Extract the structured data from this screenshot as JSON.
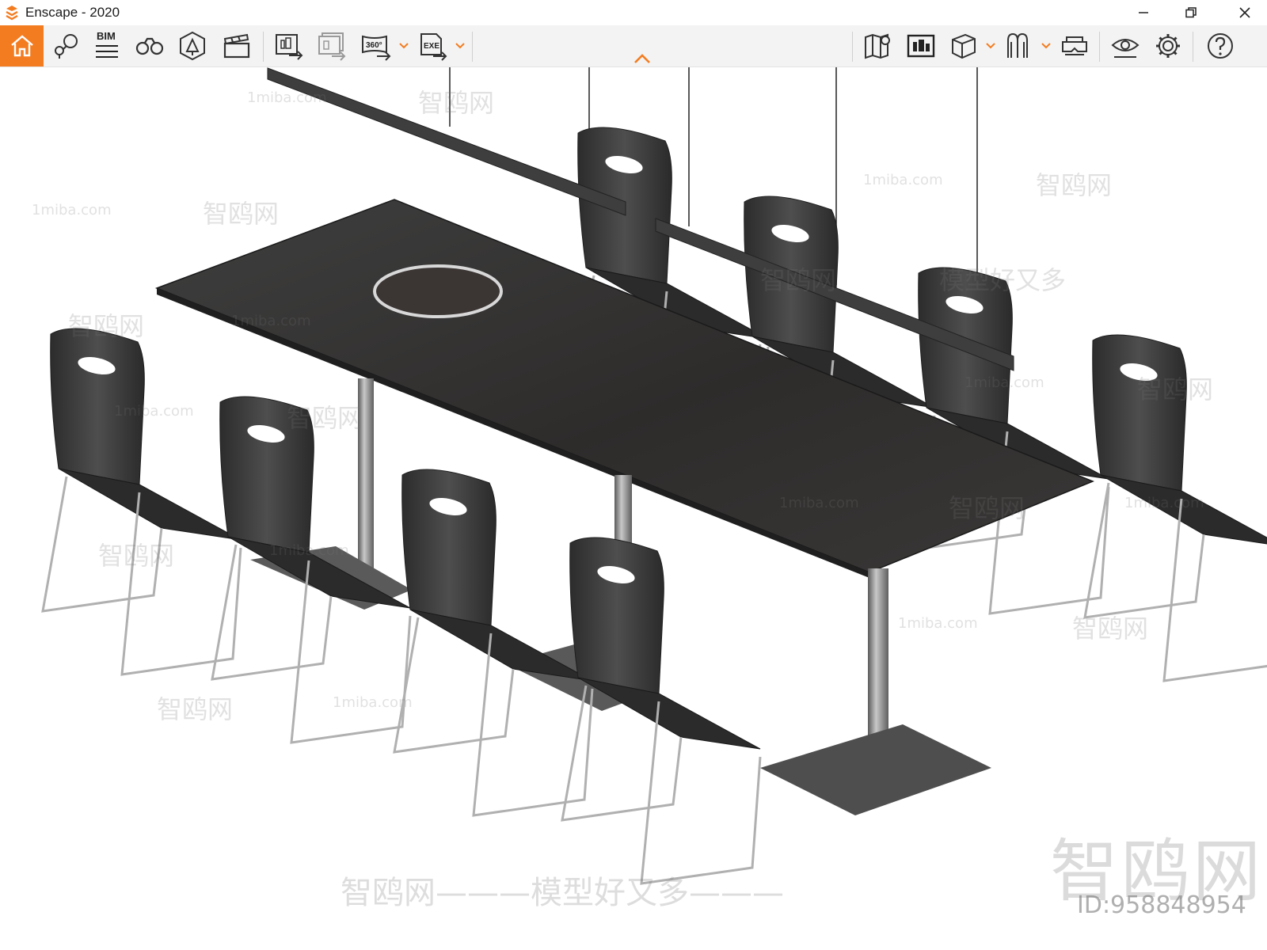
{
  "window": {
    "title": "Enscape - 2020",
    "controls": {
      "minimize": "—",
      "maximize": "❐",
      "close": "✕"
    }
  },
  "toolbar": {
    "accent_color": "#f47c20",
    "left_tools": [
      {
        "id": "home",
        "icon": "home-icon",
        "active": true
      },
      {
        "id": "views",
        "icon": "location-views-icon"
      },
      {
        "id": "bim",
        "icon": "bim-info-icon",
        "label": "BIM"
      },
      {
        "id": "walk",
        "icon": "binoculars-icon"
      },
      {
        "id": "assets",
        "icon": "asset-library-icon"
      },
      {
        "id": "video",
        "icon": "video-editor-icon"
      }
    ],
    "export_tools": [
      {
        "id": "screenshot",
        "icon": "screenshot-export-icon"
      },
      {
        "id": "batch",
        "icon": "batch-export-icon"
      },
      {
        "id": "panorama",
        "icon": "panorama-360-icon",
        "label": "360°",
        "has_dropdown": true
      },
      {
        "id": "exe",
        "icon": "exe-export-icon",
        "label": "EXE",
        "has_dropdown": true
      }
    ],
    "right_tools": [
      {
        "id": "map",
        "icon": "map-icon"
      },
      {
        "id": "site",
        "icon": "site-context-icon"
      },
      {
        "id": "cube",
        "icon": "view-cube-icon",
        "has_dropdown": true
      },
      {
        "id": "mode",
        "icon": "view-mode-icon",
        "has_dropdown": true
      },
      {
        "id": "vr",
        "icon": "vr-headset-icon"
      },
      {
        "id": "visual",
        "icon": "visual-settings-icon"
      },
      {
        "id": "settings",
        "icon": "gear-icon"
      },
      {
        "id": "help",
        "icon": "help-icon"
      }
    ],
    "collapse_icon": "chevron-up-icon"
  },
  "watermarks": {
    "site": "1miba.com",
    "brand": "智鸥网",
    "slogan": "模型好又多",
    "corner_logo": "智鸥网",
    "id_text": "ID:958848954",
    "bottom": "智鸥网———模型好又多———"
  }
}
